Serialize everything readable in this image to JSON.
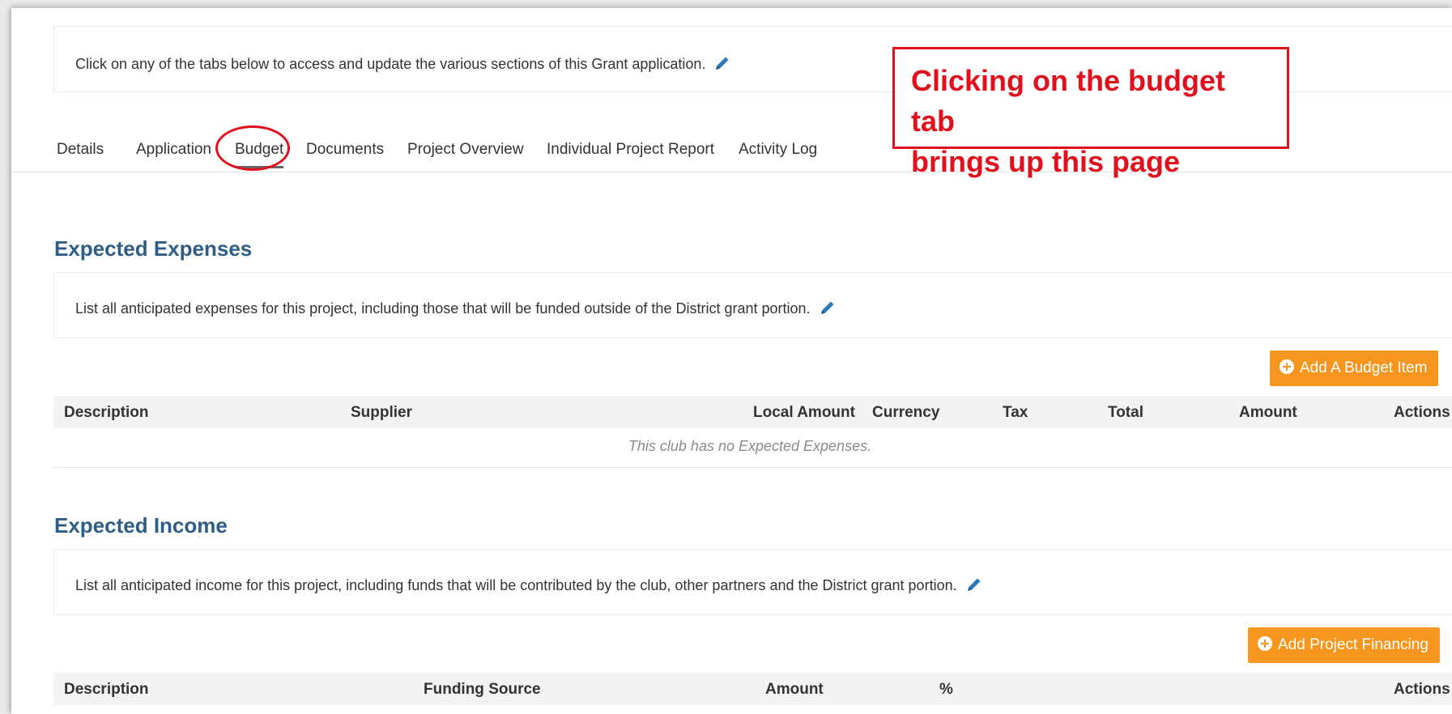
{
  "intro": {
    "text": "Click on any of the tabs below to access and update the various sections of this Grant application."
  },
  "tabs": [
    {
      "label": "Details"
    },
    {
      "label": "Application"
    },
    {
      "label": "Budget"
    },
    {
      "label": "Documents"
    },
    {
      "label": "Project Overview"
    },
    {
      "label": "Individual Project Report"
    },
    {
      "label": "Activity Log"
    }
  ],
  "active_tab": "Budget",
  "annotation": {
    "line1": "Clicking on the budget tab",
    "line2": "brings up this page",
    "color": "#e0101c"
  },
  "expenses": {
    "title": "Expected Expenses",
    "description": "List all anticipated expenses for this project, including those that will be funded outside of the District grant portion.",
    "add_button": "Add A Budget Item",
    "columns": [
      "Description",
      "Supplier",
      "Local Amount",
      "Currency",
      "Tax",
      "Total",
      "Amount",
      "Actions"
    ],
    "empty_message": "This club has no Expected Expenses."
  },
  "income": {
    "title": "Expected Income",
    "description": "List all anticipated income for this project, including funds that will be contributed by the club, other partners and the District grant portion.",
    "add_button": "Add Project Financing",
    "columns": [
      "Description",
      "Funding Source",
      "Amount",
      "%",
      "Actions"
    ]
  },
  "colors": {
    "section_title": "#2e5e86",
    "accent_button": "#f7961e",
    "pencil_icon": "#2a7ab8"
  },
  "icons": {
    "edit": "pencil-icon",
    "add": "plus-circle-icon"
  }
}
